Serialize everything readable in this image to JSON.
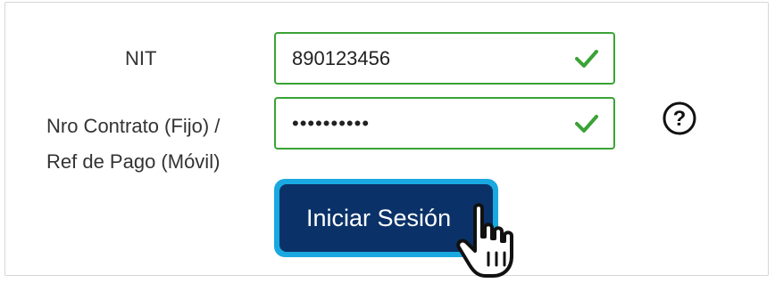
{
  "form": {
    "nit_label": "NIT",
    "nit_value": "890123456",
    "contract_label_line1": "Nro Contrato (Fijo) /",
    "contract_label_line2": "Ref de Pago (Móvil)",
    "contract_value": "••••••••••",
    "submit_label": "Iniciar Sesión"
  },
  "icons": {
    "valid": "check-icon",
    "help": "question-circle-icon",
    "pointer": "hand-pointer-icon"
  },
  "colors": {
    "valid_green": "#3aa336",
    "button_navy": "#0b3268",
    "button_outline": "#19a9e0",
    "label_text": "#333333"
  }
}
